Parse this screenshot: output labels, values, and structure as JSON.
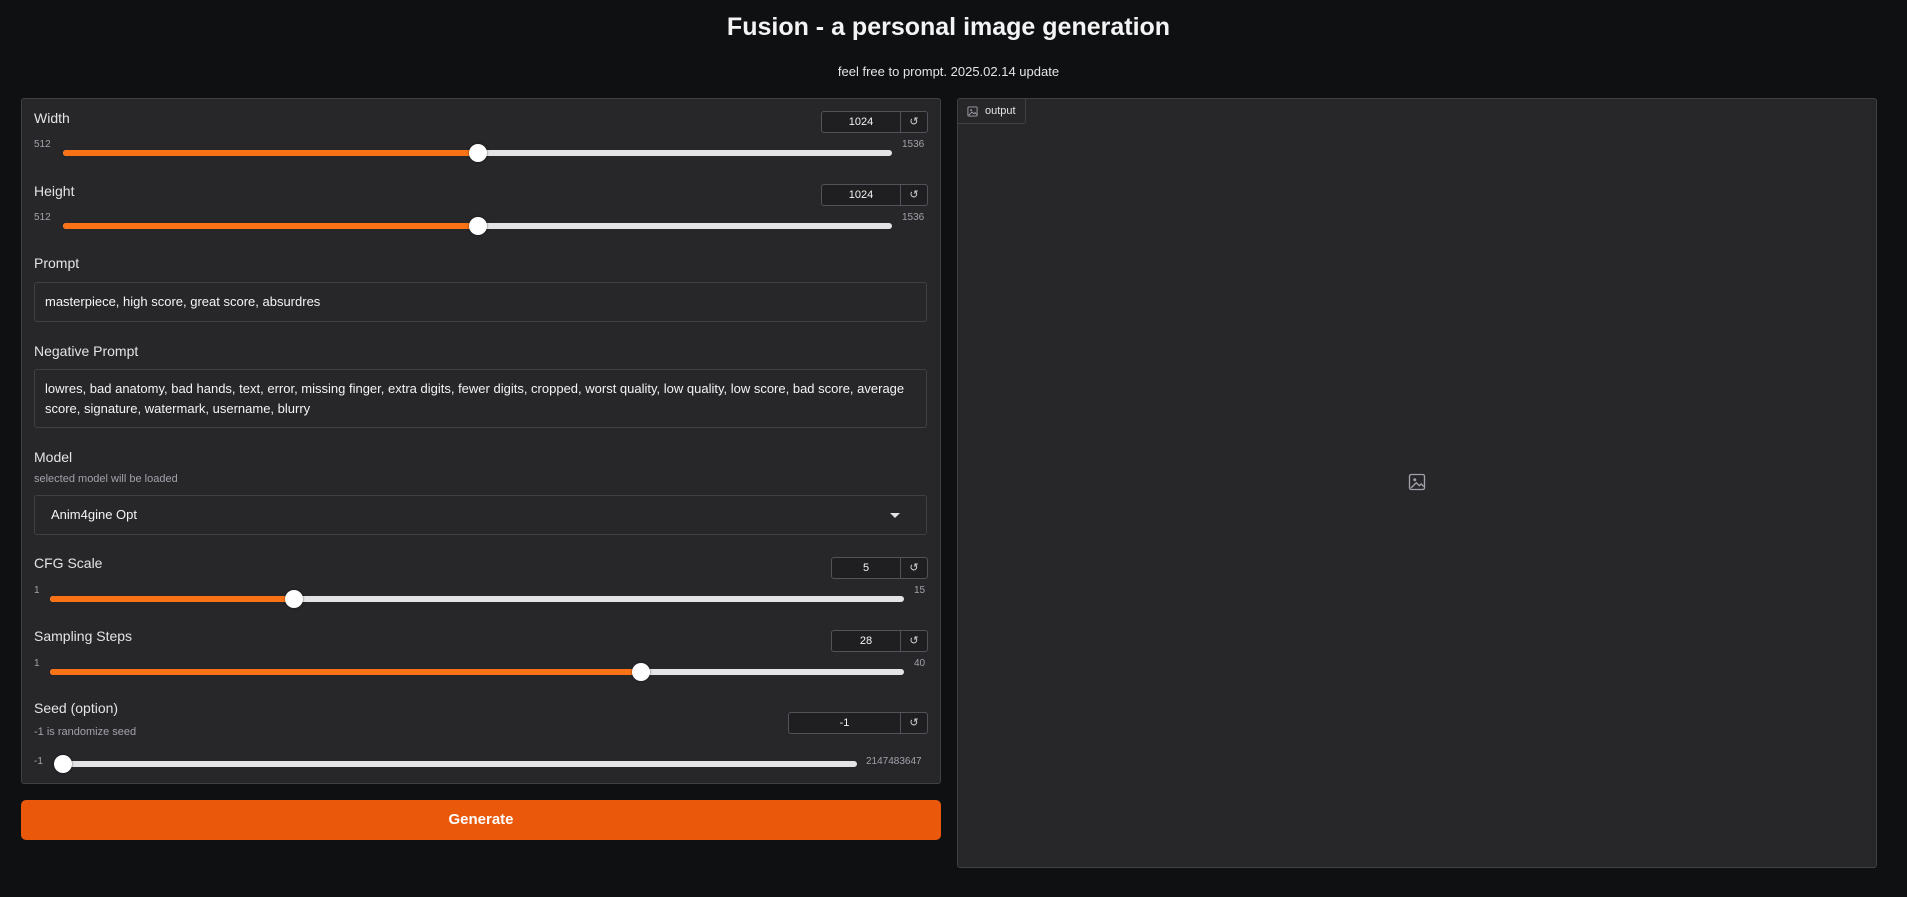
{
  "header": {
    "title": "Fusion - a personal image generation",
    "subtitle": "feel free to prompt. 2025.02.14 update"
  },
  "controls": {
    "width": {
      "label": "Width",
      "value": "1024",
      "min": "512",
      "max": "1536",
      "fraction": 0.5
    },
    "height": {
      "label": "Height",
      "value": "1024",
      "min": "512",
      "max": "1536",
      "fraction": 0.5
    },
    "prompt": {
      "label": "Prompt",
      "value": "masterpiece, high score, great score, absurdres"
    },
    "negative_prompt": {
      "label": "Negative Prompt",
      "value": "lowres, bad anatomy, bad hands, text, error, missing finger, extra digits, fewer digits, cropped, worst quality, low quality, low score, bad score, average score, signature, watermark, username, blurry"
    },
    "model": {
      "label": "Model",
      "info": "selected model will be loaded",
      "selected": "Anim4gine Opt"
    },
    "cfg_scale": {
      "label": "CFG Scale",
      "value": "5",
      "min": "1",
      "max": "15",
      "fraction": 0.2857
    },
    "sampling_steps": {
      "label": "Sampling Steps",
      "value": "28",
      "min": "1",
      "max": "40",
      "fraction": 0.6923
    },
    "seed": {
      "label": "Seed (option)",
      "info": "-1 is randomize seed",
      "value": "-1",
      "min": "-1",
      "max": "2147483647",
      "fraction": 0.0
    },
    "reset_icon": "↺"
  },
  "generate_label": "Generate",
  "output": {
    "label": "output",
    "icon": "image-icon"
  },
  "colors": {
    "accent": "#f97316",
    "button": "#ea580c",
    "panel": "#27272a",
    "background": "#0f1012"
  }
}
